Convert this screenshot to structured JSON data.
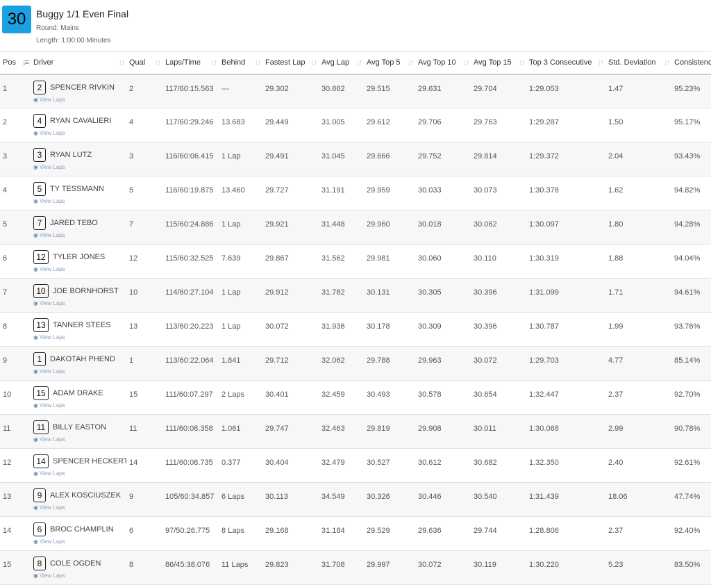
{
  "race": {
    "number": "30",
    "title": "Buggy 1/1 Even Final",
    "round_label": "Round:",
    "round": "Mains",
    "length_label": "Length:",
    "length": "1:00:00 Minutes"
  },
  "table": {
    "columns": [
      "Pos",
      "Driver",
      "Qual",
      "Laps/Time",
      "Behind",
      "Fastest Lap",
      "Avg Lap",
      "Avg Top 5",
      "Avg Top 10",
      "Avg Top 15",
      "Top 3 Consecutive",
      "Std. Deviation",
      "Consistency"
    ],
    "view_laps_label": "View Laps",
    "rows": [
      {
        "pos": "1",
        "car": "2",
        "driver": "SPENCER RIVKIN",
        "qual": "2",
        "laps": "117/60:15.563",
        "behind": "---",
        "fastest": "29.302",
        "avg": "30.862",
        "top5": "29.515",
        "top10": "29.631",
        "top15": "29.704",
        "top3c": "1:29.053",
        "std": "1.47",
        "cons": "95.23%"
      },
      {
        "pos": "2",
        "car": "4",
        "driver": "RYAN CAVALIERI",
        "qual": "4",
        "laps": "117/60:29.246",
        "behind": "13.683",
        "fastest": "29.449",
        "avg": "31.005",
        "top5": "29.612",
        "top10": "29.706",
        "top15": "29.763",
        "top3c": "1:29.287",
        "std": "1.50",
        "cons": "95.17%"
      },
      {
        "pos": "3",
        "car": "3",
        "driver": "RYAN LUTZ",
        "qual": "3",
        "laps": "116/60:06.415",
        "behind": "1 Lap",
        "fastest": "29.491",
        "avg": "31.045",
        "top5": "29.666",
        "top10": "29.752",
        "top15": "29.814",
        "top3c": "1:29.372",
        "std": "2.04",
        "cons": "93.43%"
      },
      {
        "pos": "4",
        "car": "5",
        "driver": "TY TESSMANN",
        "qual": "5",
        "laps": "116/60:19.875",
        "behind": "13.460",
        "fastest": "29.727",
        "avg": "31.191",
        "top5": "29.959",
        "top10": "30.033",
        "top15": "30.073",
        "top3c": "1:30.378",
        "std": "1.62",
        "cons": "94.82%"
      },
      {
        "pos": "5",
        "car": "7",
        "driver": "JARED TEBO",
        "qual": "7",
        "laps": "115/60:24.886",
        "behind": "1 Lap",
        "fastest": "29.921",
        "avg": "31.448",
        "top5": "29.960",
        "top10": "30.018",
        "top15": "30.062",
        "top3c": "1:30.097",
        "std": "1.80",
        "cons": "94.28%"
      },
      {
        "pos": "6",
        "car": "12",
        "driver": "TYLER JONES",
        "qual": "12",
        "laps": "115/60:32.525",
        "behind": "7.639",
        "fastest": "29.867",
        "avg": "31.562",
        "top5": "29.981",
        "top10": "30.060",
        "top15": "30.110",
        "top3c": "1:30.319",
        "std": "1.88",
        "cons": "94.04%"
      },
      {
        "pos": "7",
        "car": "10",
        "driver": "JOE BORNHORST",
        "qual": "10",
        "laps": "114/60:27.104",
        "behind": "1 Lap",
        "fastest": "29.912",
        "avg": "31.782",
        "top5": "30.131",
        "top10": "30.305",
        "top15": "30.396",
        "top3c": "1:31.099",
        "std": "1.71",
        "cons": "94.61%"
      },
      {
        "pos": "8",
        "car": "13",
        "driver": "TANNER STEES",
        "qual": "13",
        "laps": "113/60:20.223",
        "behind": "1 Lap",
        "fastest": "30.072",
        "avg": "31.936",
        "top5": "30.178",
        "top10": "30.309",
        "top15": "30.396",
        "top3c": "1:30.787",
        "std": "1.99",
        "cons": "93.76%"
      },
      {
        "pos": "9",
        "car": "1",
        "driver": "DAKOTAH PHEND",
        "qual": "1",
        "laps": "113/60:22.064",
        "behind": "1.841",
        "fastest": "29.712",
        "avg": "32.062",
        "top5": "29.788",
        "top10": "29.963",
        "top15": "30.072",
        "top3c": "1:29.703",
        "std": "4.77",
        "cons": "85.14%"
      },
      {
        "pos": "10",
        "car": "15",
        "driver": "ADAM DRAKE",
        "qual": "15",
        "laps": "111/60:07.297",
        "behind": "2 Laps",
        "fastest": "30.401",
        "avg": "32.459",
        "top5": "30.493",
        "top10": "30.578",
        "top15": "30.654",
        "top3c": "1:32.447",
        "std": "2.37",
        "cons": "92.70%"
      },
      {
        "pos": "11",
        "car": "11",
        "driver": "BILLY EASTON",
        "qual": "11",
        "laps": "111/60:08.358",
        "behind": "1.061",
        "fastest": "29.747",
        "avg": "32.463",
        "top5": "29.819",
        "top10": "29.908",
        "top15": "30.011",
        "top3c": "1:30.068",
        "std": "2.99",
        "cons": "90.78%"
      },
      {
        "pos": "12",
        "car": "14",
        "driver": "SPENCER HECKERT",
        "qual": "14",
        "laps": "111/60:08.735",
        "behind": "0.377",
        "fastest": "30.404",
        "avg": "32.479",
        "top5": "30.527",
        "top10": "30.612",
        "top15": "30.682",
        "top3c": "1:32.350",
        "std": "2.40",
        "cons": "92.61%"
      },
      {
        "pos": "13",
        "car": "9",
        "driver": "ALEX KOSCIUSZEK",
        "qual": "9",
        "laps": "105/60:34.857",
        "behind": "6 Laps",
        "fastest": "30.113",
        "avg": "34.549",
        "top5": "30.326",
        "top10": "30.446",
        "top15": "30.540",
        "top3c": "1:31.439",
        "std": "18.06",
        "cons": "47.74%"
      },
      {
        "pos": "14",
        "car": "6",
        "driver": "BROC CHAMPLIN",
        "qual": "6",
        "laps": "97/50:26.775",
        "behind": "8 Laps",
        "fastest": "29.168",
        "avg": "31.184",
        "top5": "29.529",
        "top10": "29.636",
        "top15": "29.744",
        "top3c": "1:28.806",
        "std": "2.37",
        "cons": "92.40%"
      },
      {
        "pos": "15",
        "car": "8",
        "driver": "COLE OGDEN",
        "qual": "8",
        "laps": "86/45:38.076",
        "behind": "11 Laps",
        "fastest": "29.823",
        "avg": "31.708",
        "top5": "29.997",
        "top10": "30.072",
        "top15": "30.119",
        "top3c": "1:30.220",
        "std": "5.23",
        "cons": "83.50%"
      }
    ]
  }
}
